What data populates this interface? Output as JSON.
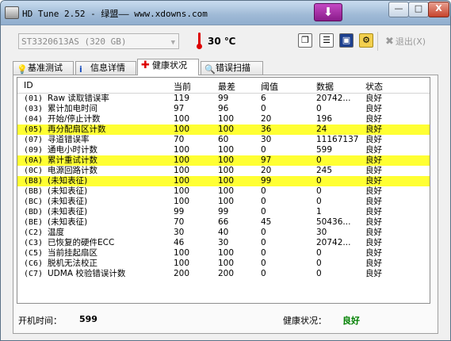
{
  "window": {
    "title": "HD Tune 2.52 - 绿盟—— www.xdowns.com",
    "minimize_label": "—",
    "maximize_label": "□",
    "close_label": "X"
  },
  "toolbar": {
    "drive": "ST3320613AS (320 GB)",
    "temperature": "30 ℃",
    "exit_label": "退出(X)"
  },
  "tabs": [
    {
      "label": "基准测试"
    },
    {
      "label": "信息详情"
    },
    {
      "label": "健康状况"
    },
    {
      "label": "错误扫描"
    }
  ],
  "table": {
    "columns": [
      "ID",
      "当前",
      "最差",
      "阈值",
      "数据",
      "状态"
    ],
    "rows": [
      {
        "id": "(01)",
        "name": "Raw 读取错误率",
        "current": "119",
        "worst": "99",
        "threshold": "6",
        "data": "20742...",
        "status": "良好",
        "highlight": false
      },
      {
        "id": "(03)",
        "name": "累计加电时间",
        "current": "97",
        "worst": "96",
        "threshold": "0",
        "data": "0",
        "status": "良好",
        "highlight": false
      },
      {
        "id": "(04)",
        "name": "开始/停止计数",
        "current": "100",
        "worst": "100",
        "threshold": "20",
        "data": "196",
        "status": "良好",
        "highlight": false
      },
      {
        "id": "(05)",
        "name": "再分配扇区计数",
        "current": "100",
        "worst": "100",
        "threshold": "36",
        "data": "24",
        "status": "良好",
        "highlight": true
      },
      {
        "id": "(07)",
        "name": "寻道错误率",
        "current": "70",
        "worst": "60",
        "threshold": "30",
        "data": "11167137",
        "status": "良好",
        "highlight": false
      },
      {
        "id": "(09)",
        "name": "通电小时计数",
        "current": "100",
        "worst": "100",
        "threshold": "0",
        "data": "599",
        "status": "良好",
        "highlight": false
      },
      {
        "id": "(0A)",
        "name": "累计重试计数",
        "current": "100",
        "worst": "100",
        "threshold": "97",
        "data": "0",
        "status": "良好",
        "highlight": true
      },
      {
        "id": "(0C)",
        "name": "电源回路计数",
        "current": "100",
        "worst": "100",
        "threshold": "20",
        "data": "245",
        "status": "良好",
        "highlight": false
      },
      {
        "id": "(B8)",
        "name": "(未知表征)",
        "current": "100",
        "worst": "100",
        "threshold": "99",
        "data": "0",
        "status": "良好",
        "highlight": true
      },
      {
        "id": "(BB)",
        "name": "(未知表征)",
        "current": "100",
        "worst": "100",
        "threshold": "0",
        "data": "0",
        "status": "良好",
        "highlight": false
      },
      {
        "id": "(BC)",
        "name": "(未知表征)",
        "current": "100",
        "worst": "100",
        "threshold": "0",
        "data": "0",
        "status": "良好",
        "highlight": false
      },
      {
        "id": "(BD)",
        "name": "(未知表征)",
        "current": "99",
        "worst": "99",
        "threshold": "0",
        "data": "1",
        "status": "良好",
        "highlight": false
      },
      {
        "id": "(BE)",
        "name": "(未知表征)",
        "current": "70",
        "worst": "66",
        "threshold": "45",
        "data": "50436...",
        "status": "良好",
        "highlight": false
      },
      {
        "id": "(C2)",
        "name": "温度",
        "current": "30",
        "worst": "40",
        "threshold": "0",
        "data": "30",
        "status": "良好",
        "highlight": false
      },
      {
        "id": "(C3)",
        "name": "已恢复的硬件ECC",
        "current": "46",
        "worst": "30",
        "threshold": "0",
        "data": "20742...",
        "status": "良好",
        "highlight": false
      },
      {
        "id": "(C5)",
        "name": "当前挂起扇区",
        "current": "100",
        "worst": "100",
        "threshold": "0",
        "data": "0",
        "status": "良好",
        "highlight": false
      },
      {
        "id": "(C6)",
        "name": "脱机无法校正",
        "current": "100",
        "worst": "100",
        "threshold": "0",
        "data": "0",
        "status": "良好",
        "highlight": false
      },
      {
        "id": "(C7)",
        "name": "UDMA 校验错误计数",
        "current": "200",
        "worst": "200",
        "threshold": "0",
        "data": "0",
        "status": "良好",
        "highlight": false
      }
    ]
  },
  "status_bar": {
    "power_on_label": "开机时间：",
    "power_on_value": "599",
    "health_label": "健康状况：",
    "health_value": "良好",
    "health_color": "#008000"
  },
  "colors": {
    "highlight": "#ffff33"
  }
}
